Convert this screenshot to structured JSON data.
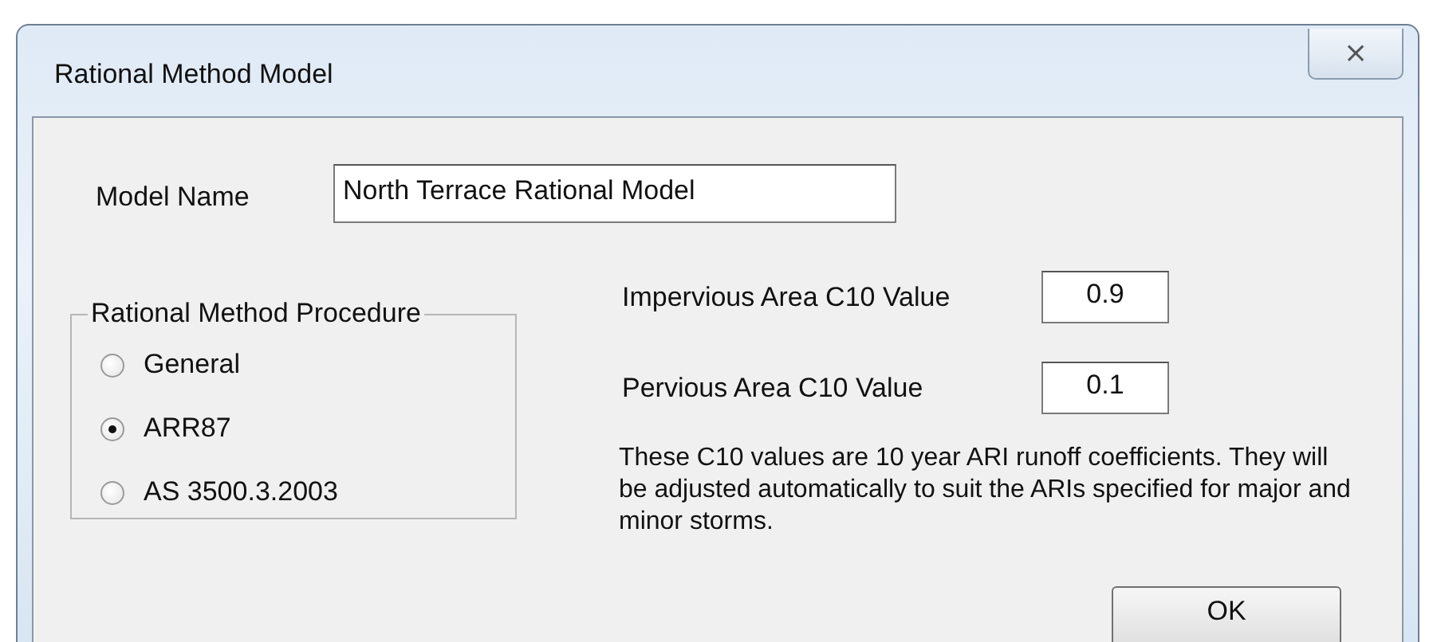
{
  "window": {
    "title": "Rational Method Model",
    "close": "⨯"
  },
  "model_name": {
    "label": "Model Name",
    "value": "North Terrace Rational Model"
  },
  "procedure": {
    "title": "Rational Method Procedure",
    "options": [
      {
        "label": "General",
        "selected": false
      },
      {
        "label": "ARR87",
        "selected": true
      },
      {
        "label": "AS 3500.3.2003",
        "selected": false
      }
    ]
  },
  "coefficients": [
    {
      "label": "Impervious Area C10 Value",
      "value": "0.9"
    },
    {
      "label": "Pervious Area C10 Value",
      "value": "0.1"
    }
  ],
  "note": "These C10 values are 10 year ARI runoff coefficients. They will be adjusted automatically to suit the ARIs specified for major and minor storms.",
  "buttons": [
    "OK"
  ]
}
